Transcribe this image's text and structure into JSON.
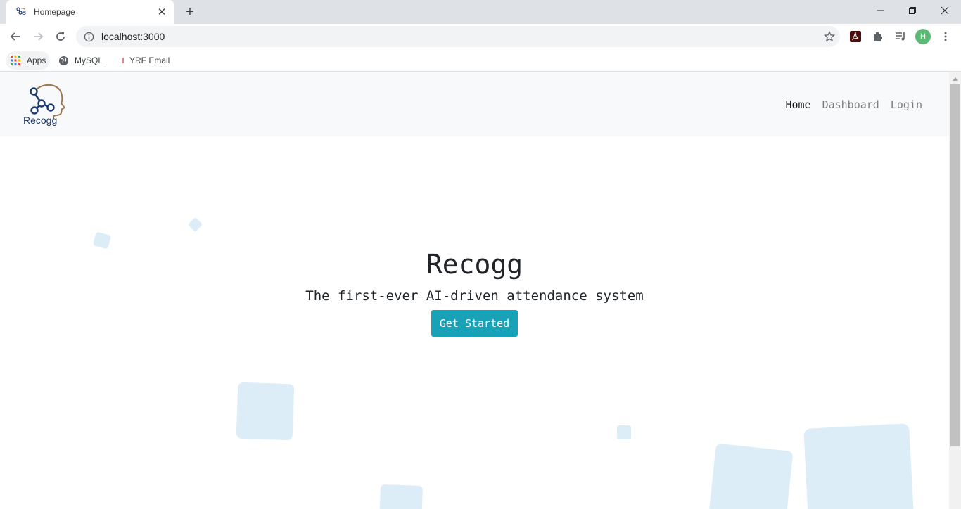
{
  "browser": {
    "tab": {
      "title": "Homepage"
    },
    "address": {
      "url": "localhost:3000"
    },
    "profile_initial": "H",
    "bookmarks": [
      {
        "label": "Apps",
        "icon": "apps-grid-icon"
      },
      {
        "label": "MySQL",
        "icon": "globe-icon"
      },
      {
        "label": "YRF Email",
        "icon": "bookmark-favicon-icon"
      }
    ],
    "colors": {
      "tabstrip": "#dee1e6",
      "omnibox": "#f1f3f4",
      "avatar": "#5bb974"
    }
  },
  "site": {
    "brand": {
      "logo_text": "Recogg"
    },
    "nav": [
      {
        "label": "Home",
        "active": true
      },
      {
        "label": "Dashboard",
        "active": false
      },
      {
        "label": "Login",
        "active": false
      }
    ],
    "hero": {
      "title": "Recogg",
      "subtitle": "The first-ever AI-driven attendance system",
      "cta_label": "Get Started"
    },
    "colors": {
      "navbar_bg": "#f8f9fa",
      "cta_bg": "#17a2b8",
      "decor_squares": "#dcedf8",
      "logo_navy": "#1d3c6e",
      "logo_brown": "#a07850"
    }
  }
}
